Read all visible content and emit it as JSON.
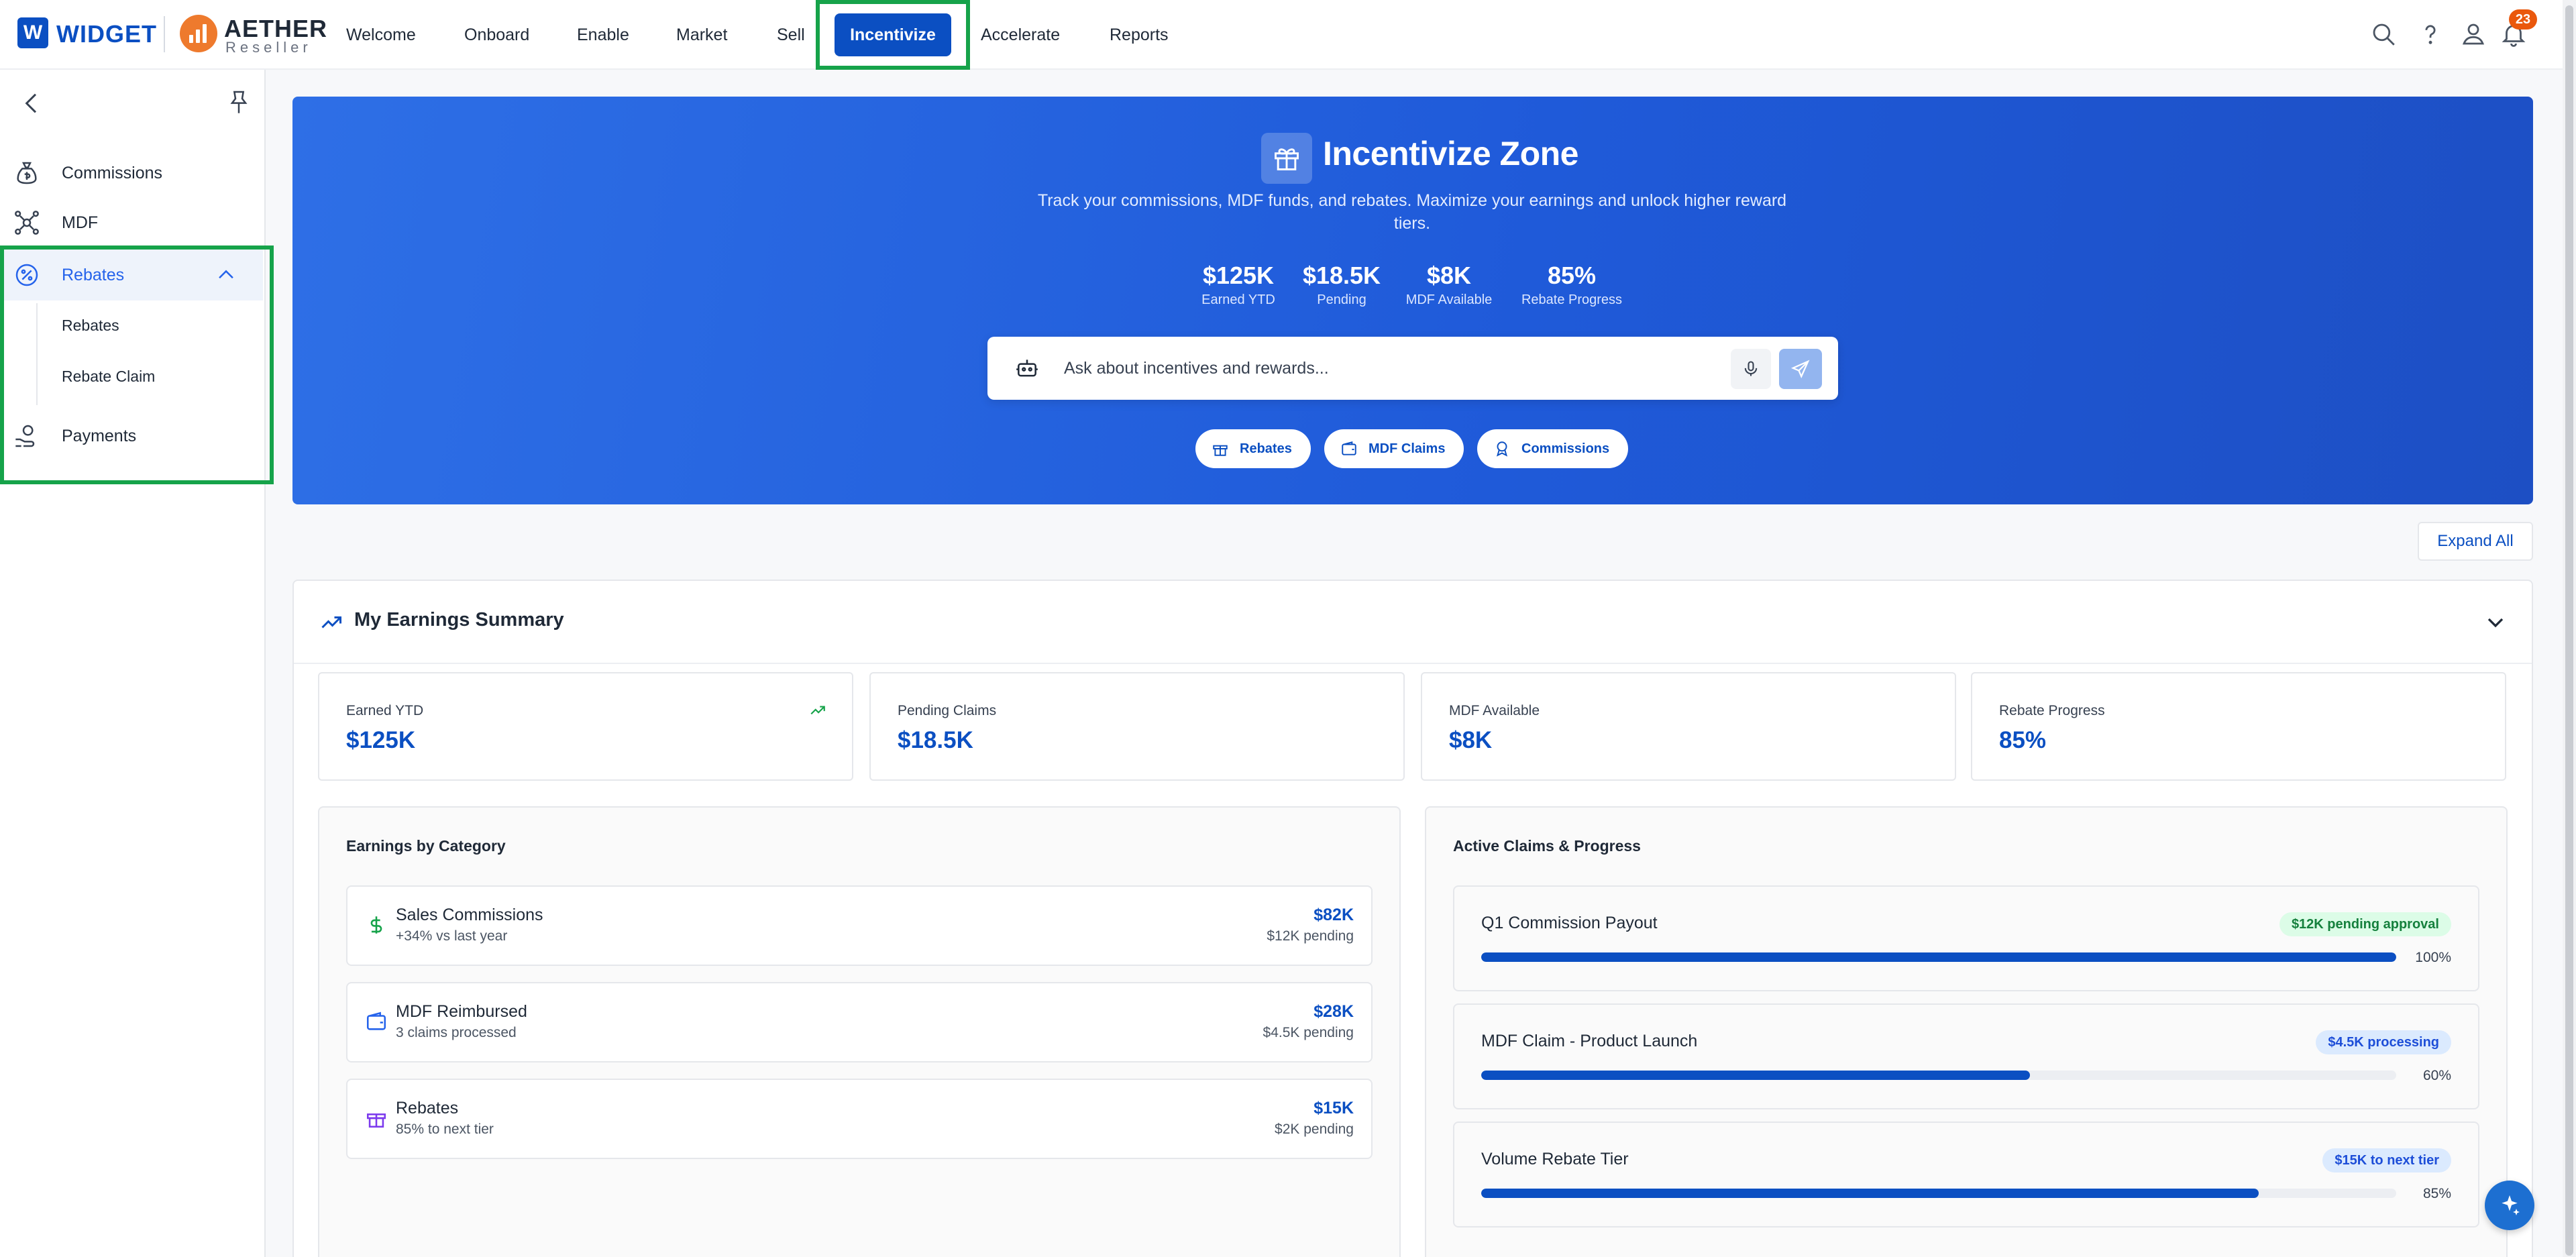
{
  "brand": {
    "widget_letter": "W",
    "widget_name": "WIDGET",
    "aether_title": "AETHER",
    "aether_sub": "Reseller"
  },
  "nav": {
    "items": [
      "Welcome",
      "Onboard",
      "Enable",
      "Market",
      "Sell",
      "Incentivize",
      "Accelerate",
      "Reports"
    ],
    "active": "Incentivize"
  },
  "topbar": {
    "notification_count": "23"
  },
  "sidebar": {
    "items": [
      {
        "label": "Commissions",
        "icon": "money-bag-icon"
      },
      {
        "label": "MDF",
        "icon": "network-icon"
      },
      {
        "label": "Rebates",
        "icon": "percent-badge-icon",
        "expanded": true
      },
      {
        "label": "Payments",
        "icon": "hand-coin-icon"
      }
    ],
    "sub_items": [
      "Rebates",
      "Rebate Claim"
    ]
  },
  "hero": {
    "title": "Incentivize Zone",
    "description": "Track your commissions, MDF funds, and rebates. Maximize your earnings and unlock higher reward tiers.",
    "stats": [
      {
        "value": "$125K",
        "label": "Earned YTD"
      },
      {
        "value": "$18.5K",
        "label": "Pending"
      },
      {
        "value": "$8K",
        "label": "MDF Available"
      },
      {
        "value": "85%",
        "label": "Rebate Progress"
      }
    ],
    "search_placeholder": "Ask about incentives and rewards...",
    "chips": [
      "Rebates",
      "MDF Claims",
      "Commissions"
    ]
  },
  "expand_all_label": "Expand All",
  "earnings": {
    "title": "My Earnings Summary",
    "kpis": [
      {
        "label": "Earned YTD",
        "value": "$125K"
      },
      {
        "label": "Pending Claims",
        "value": "$18.5K"
      },
      {
        "label": "MDF Available",
        "value": "$8K"
      },
      {
        "label": "Rebate Progress",
        "value": "85%"
      }
    ],
    "category_title": "Earnings by Category",
    "categories": [
      {
        "name": "Sales Commissions",
        "sub": "+34% vs last year",
        "amount": "$82K",
        "pending": "$12K pending",
        "color": "#16a34a"
      },
      {
        "name": "MDF Reimbursed",
        "sub": "3 claims processed",
        "amount": "$28K",
        "pending": "$4.5K pending",
        "color": "#2563eb"
      },
      {
        "name": "Rebates",
        "sub": "85% to next tier",
        "amount": "$15K",
        "pending": "$2K pending",
        "color": "#7c3aed"
      }
    ],
    "claims_title": "Active Claims & Progress",
    "claims": [
      {
        "name": "Q1 Commission Payout",
        "badge": "$12K pending approval",
        "badge_bg": "#dcfce7",
        "badge_fg": "#15803d",
        "progress": 100,
        "pct": "100%"
      },
      {
        "name": "MDF Claim - Product Launch",
        "badge": "$4.5K processing",
        "badge_bg": "#dbeafe",
        "badge_fg": "#1d4ed8",
        "progress": 60,
        "pct": "60%"
      },
      {
        "name": "Volume Rebate Tier",
        "badge": "$15K to next tier",
        "badge_bg": "#dbeafe",
        "badge_fg": "#1d4ed8",
        "progress": 85,
        "pct": "85%"
      }
    ]
  },
  "colors": {
    "primary": "#0b4fc2",
    "highlight": "#16a34a",
    "accent_orange": "#ee7a2d"
  }
}
